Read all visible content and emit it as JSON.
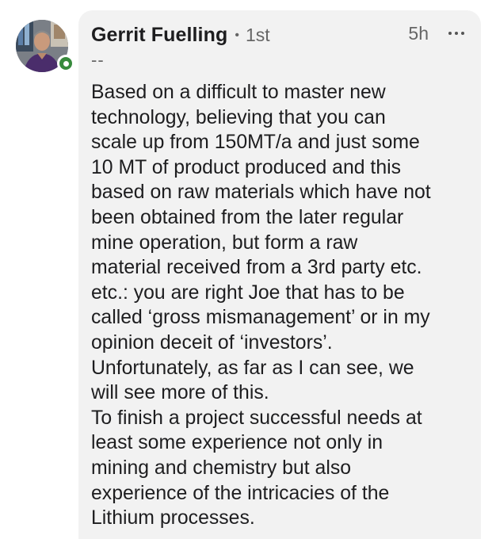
{
  "comment": {
    "author": {
      "name": "Gerrit Fuelling",
      "separator": "•",
      "connection_degree": "1st",
      "headline": "--",
      "online_status_color": "#378a3c"
    },
    "timestamp": "5h",
    "more_icon": "ellipsis-icon",
    "text": "Based on a difficult to master new\ntechnology, believing that you can\nscale up from 150MT/a and just some\n10 MT of product produced and this\nbased on raw materials which have not\nbeen obtained from the later regular\nmine operation, but form a raw\nmaterial received from a 3rd party etc.\netc.: you are right Joe that has to be\ncalled ‘gross mismanagement’ or in my\nopinion deceit of ‘investors’.\nUnfortunately, as far as I can see, we\nwill see more of this.\nTo finish a project successful needs at\nleast some experience not only in\nmining and chemistry but also\nexperience of the intricacies of the\nLithium processes."
  }
}
